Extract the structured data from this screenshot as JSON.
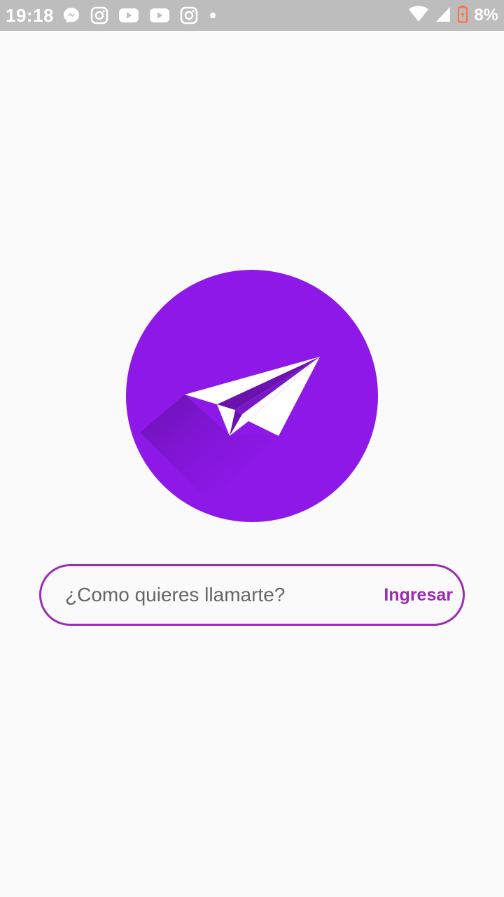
{
  "status_bar": {
    "time": "19:18",
    "battery": "8%",
    "notification_icons": [
      "messenger-icon",
      "instagram-icon",
      "youtube-icon",
      "youtube-icon",
      "instagram-icon",
      "dot-icon"
    ],
    "system_icons": [
      "wifi-icon",
      "signal-icon",
      "battery-low-icon"
    ],
    "battery_color": "#ff7043"
  },
  "logo": {
    "icon": "paper-plane-icon",
    "circle_color": "#8e18e8"
  },
  "form": {
    "placeholder": "¿Como quieres llamarte?",
    "value": "",
    "submit_label": "Ingresar",
    "accent_color": "#9a2db3"
  }
}
